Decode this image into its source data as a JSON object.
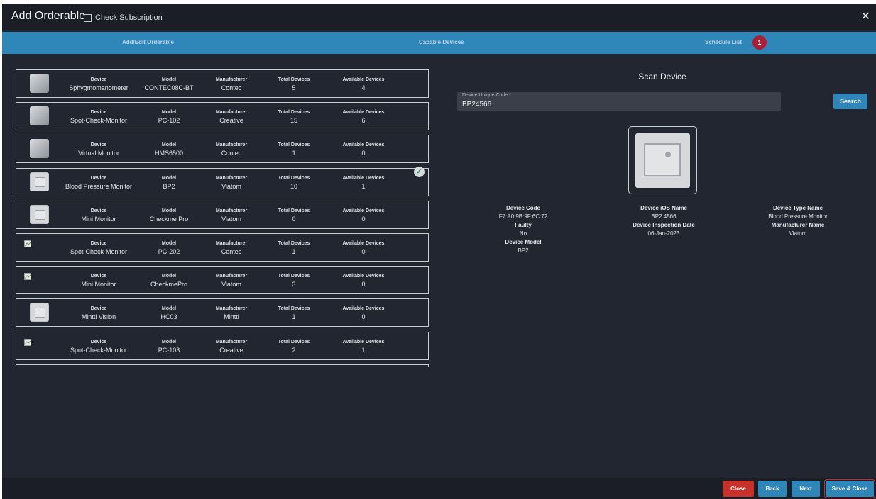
{
  "window": {
    "title": "Add Orderable",
    "check_label": "Check Subscription"
  },
  "tabs": [
    {
      "label": "Add/Edit Orderable"
    },
    {
      "label": "Capable Devices"
    },
    {
      "label": "Schedule List",
      "badge": "1"
    }
  ],
  "columns": {
    "device": "Device",
    "model": "Model",
    "manufacturer": "Manufacturer",
    "total": "Total Devices",
    "available": "Available Devices"
  },
  "devices": [
    {
      "device": "Sphygmomanometer",
      "model": "CONTEC08C-BT",
      "manufacturer": "Contec",
      "total": "5",
      "available": "4",
      "image": "photo"
    },
    {
      "device": "Spot-Check-Monitor",
      "model": "PC-102",
      "manufacturer": "Creative",
      "total": "15",
      "available": "6",
      "image": "photo"
    },
    {
      "device": "Virtual Monitor",
      "model": "HMS6500",
      "manufacturer": "Contec",
      "total": "1",
      "available": "0",
      "image": "photo"
    },
    {
      "device": "Blood Pressure Monitor",
      "model": "BP2",
      "manufacturer": "Viatom",
      "total": "10",
      "available": "1",
      "image": "placeholder",
      "selected": true
    },
    {
      "device": "Mini Monitor",
      "model": "Checkme Pro",
      "manufacturer": "Viatom",
      "total": "0",
      "available": "0",
      "image": "placeholder"
    },
    {
      "device": "Spot-Check-Monitor",
      "model": "PC-202",
      "manufacturer": "Contec",
      "total": "1",
      "available": "0",
      "image": "broken"
    },
    {
      "device": "Mini Monitor",
      "model": "CheckmePro",
      "manufacturer": "Viatom",
      "total": "3",
      "available": "0",
      "image": "broken"
    },
    {
      "device": "Mintti Vision",
      "model": "HC03",
      "manufacturer": "Mintti",
      "total": "1",
      "available": "0",
      "image": "placeholder"
    },
    {
      "device": "Spot-Check-Monitor",
      "model": "PC-103",
      "manufacturer": "Creative",
      "total": "2",
      "available": "1",
      "image": "broken"
    }
  ],
  "scan": {
    "title": "Scan Device",
    "field_label": "Device Unique Code *",
    "field_value": "BP24566",
    "search_label": "Search",
    "details": {
      "device_code_label": "Device Code",
      "device_code": "F7:A0:9B:9F:6C:72",
      "faulty_label": "Faulty",
      "faulty": "No",
      "device_model_label": "Device Model",
      "device_model": "BP2",
      "ios_name_label": "Device iOS Name",
      "ios_name": "BP2 4566",
      "inspection_label": "Device Inspection Date",
      "inspection": "06-Jan-2023",
      "type_name_label": "Device Type Name",
      "type_name": "Blood Pressure Monitor",
      "manufacturer_label": "Manufacturer Name",
      "manufacturer": "Viatom"
    }
  },
  "footer": {
    "close": "Close",
    "back": "Back",
    "next": "Next",
    "save_close": "Save & Close"
  }
}
